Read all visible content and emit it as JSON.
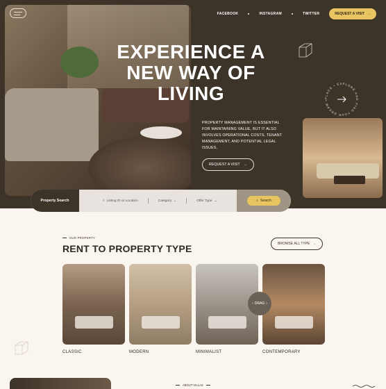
{
  "nav": {
    "links": [
      "FACEBOOK",
      "INSTAGRAM",
      "TWITTER"
    ],
    "cta_label": "REQUEST A VISIT"
  },
  "hero": {
    "title": "EXPERIENCE A NEW WAY OF LIVING",
    "description": "PROPERTY MANAGEMENT IS ESSENTIAL FOR MAINTAINING VALUE, BUT IT ALSO INVOLVES OPERATIONAL COSTS, TENANT MANAGEMENT, AND POTENTIAL LEGAL ISSUES.",
    "button_label": "REQUEST A VISIT",
    "badge_text": "PLACE • EXPLORE AND FIND YOUR DREAM •"
  },
  "search": {
    "label": "Property Search",
    "placeholder": "Listing ID or Location",
    "filters": [
      "Category",
      "Offer Type"
    ],
    "button_label": "Search"
  },
  "section": {
    "kicker": "OUR PROPERTY",
    "title": "RENT TO PROPERTY TYPE",
    "browse_label": "BROWSE ALL TYPE",
    "cards": [
      {
        "label": "CLASSIC"
      },
      {
        "label": "MODERN"
      },
      {
        "label": "MINIMALIST"
      },
      {
        "label": "CONTEMPORARY"
      }
    ],
    "drag_label": "DRAG"
  },
  "about": {
    "kicker": "ABOUT VILLAS"
  },
  "colors": {
    "dark": "#3c3329",
    "accent": "#e9c561",
    "background": "#fbf5ef"
  }
}
